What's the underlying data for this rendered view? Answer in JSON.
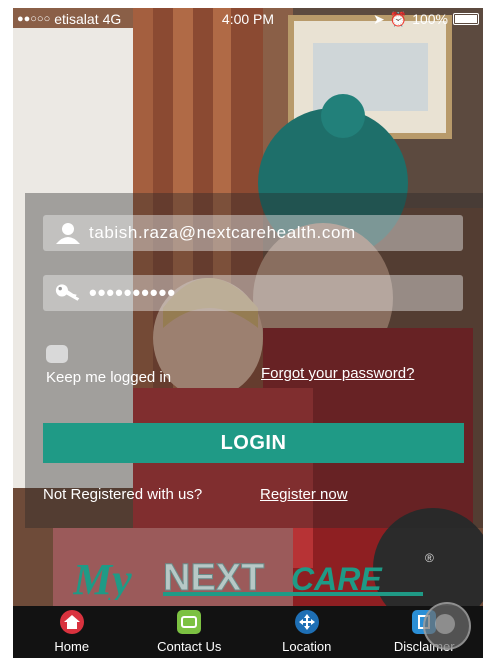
{
  "status_bar": {
    "carrier": "etisalat",
    "network": "4G",
    "time": "4:00 PM",
    "battery": "100%"
  },
  "login_form": {
    "email_value": "tabish.raza@nextcarehealth.com",
    "password_value": "••••••••••",
    "keep_logged_in_label": "Keep me logged in",
    "forgot_password_label": "Forgot your password?",
    "login_button_label": "LOGIN",
    "not_registered_text": "Not Registered with us?",
    "register_link_label": "Register now"
  },
  "brand": {
    "logo_text_my": "My",
    "logo_text_next": "NEXT",
    "logo_text_care": "CARE",
    "registered_mark": "®"
  },
  "tab_bar": {
    "items": [
      {
        "label": "Home",
        "icon": "home-icon",
        "color": "#d9323e"
      },
      {
        "label": "Contact Us",
        "icon": "contact-icon",
        "color": "#7cc142"
      },
      {
        "label": "Location",
        "icon": "location-icon",
        "color": "#1e6fb5"
      },
      {
        "label": "Disclaimer",
        "icon": "disclaimer-icon",
        "color": "#2b8fd6"
      }
    ]
  },
  "colors": {
    "accent": "#1f9a86",
    "tab_bar_bg": "#121212"
  }
}
